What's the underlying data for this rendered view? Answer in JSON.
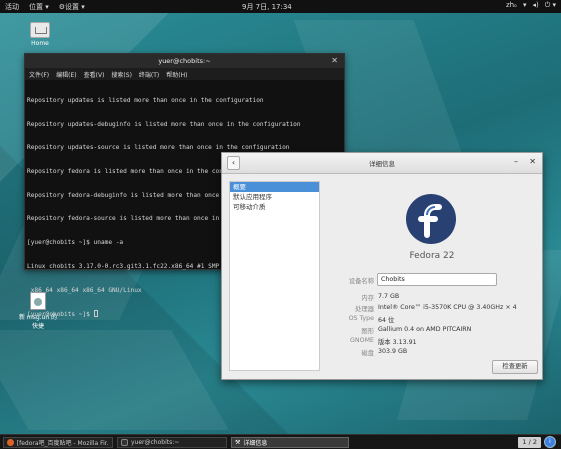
{
  "topbar": {
    "activities": "活动",
    "places": "位置",
    "settings": "设置",
    "clock": "9月 7日, 17:34",
    "tray_lang": "zhₒ"
  },
  "desktop_icons": [
    {
      "label": "Home"
    },
    {
      "label": "新 msg.un 的快捷"
    }
  ],
  "terminal": {
    "title": "yuer@chobits:~",
    "menu": [
      "文件(F)",
      "编辑(E)",
      "查看(V)",
      "搜索(S)",
      "终端(T)",
      "帮助(H)"
    ],
    "lines": [
      "Repository updates is listed more than once in the configuration",
      "Repository updates-debuginfo is listed more than once in the configuration",
      "Repository updates-source is listed more than once in the configuration",
      "Repository fedora is listed more than once in the configuration",
      "Repository fedora-debuginfo is listed more than once in the configuration",
      "Repository fedora-source is listed more than once in the configuration",
      "[yuer@chobits ~]$ uname -a",
      "Linux chobits 3.17.0-0.rc3.git3.1.fc22.x86_64 #1 SMP Fri Sep 5 14:30:55 UTC 2014",
      " x86_64 x86_64 x86_64 GNU/Linux"
    ],
    "prompt": "[yuer@chobits ~]$ "
  },
  "details": {
    "title": "详细信息",
    "sidebar": [
      "概要",
      "默认应用程序",
      "可移动介质"
    ],
    "os_name": "Fedora 22",
    "rows": [
      {
        "label": "设备名称",
        "value": "Chobits"
      },
      {
        "label": "内存",
        "value": "7.7 GB"
      },
      {
        "label": "处理器",
        "value": "Intel® Core™ i5-3570K CPU @ 3.40GHz × 4"
      },
      {
        "label": "OS Type",
        "value": "64 位"
      },
      {
        "label": "图形",
        "value": "Gallium 0.4 on AMD PITCAIRN"
      },
      {
        "label": "GNOME",
        "value": "版本 3.13.91"
      },
      {
        "label": "磁盘",
        "value": "303.9 GB"
      }
    ],
    "check_update": "检查更新",
    "logo_color": "#294172"
  },
  "taskbar": {
    "tasks": [
      "[fedora吧_百度贴吧 - Mozilla Fir...",
      "yuer@chobits:~",
      "详细信息"
    ],
    "workspace": "1 / 2"
  }
}
